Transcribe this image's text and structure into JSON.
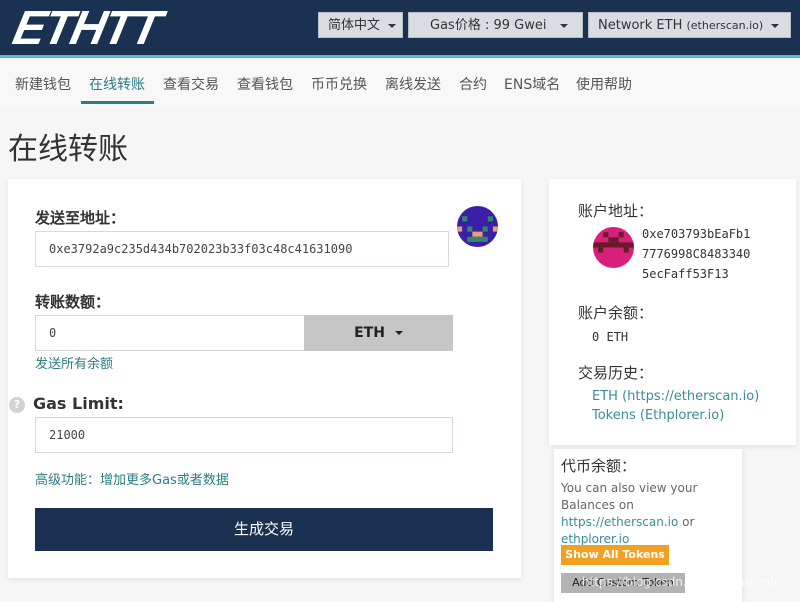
{
  "header": {
    "logo": "ETHTT",
    "language": "简体中文",
    "gas_price": "Gas价格 : 99 Gwei",
    "network_prefix": "Network ETH ",
    "network_suffix": "(etherscan.io)"
  },
  "nav": {
    "items": [
      {
        "label": "新建钱包"
      },
      {
        "label": "在线转账",
        "active": true
      },
      {
        "label": "查看交易"
      },
      {
        "label": "查看钱包"
      },
      {
        "label": "币币兑换"
      },
      {
        "label": "离线发送"
      },
      {
        "label": "合约"
      },
      {
        "label": "ENS域名"
      },
      {
        "label": "使用帮助"
      }
    ]
  },
  "page": {
    "title": "在线转账"
  },
  "form": {
    "to_label": "发送至地址：",
    "to_value": "0xe3792a9c235d434b702023b33f03c48c41631090",
    "amount_label": "转账数额：",
    "amount_value": "0",
    "currency": "ETH",
    "send_all": "发送所有余额",
    "gas_limit_label": "Gas Limit:",
    "gas_limit_value": "21000",
    "help_icon": "?",
    "advanced_link": "高级功能：增加更多Gas或者数据",
    "generate_button": "生成交易"
  },
  "account": {
    "address_label": "账户地址：",
    "address_lines": [
      "0xe703793bEaFb1",
      "7776998C8483340",
      "5ecFaff53F13"
    ],
    "balance_label": "账户余额：",
    "balance_value": "0 ETH",
    "history_label": "交易历史：",
    "history_links": [
      "ETH (https://etherscan.io)",
      "Tokens (Ethplorer.io)"
    ]
  },
  "tokens": {
    "title": "代币余额：",
    "text_prefix": "You can also view your Balances on ",
    "link1": "https://etherscan.io",
    "text_mid": " or ",
    "link2": "ethplorer.io",
    "show_all_button": "Show All Tokens",
    "add_custom_button": "Add Custom Token"
  },
  "colors": {
    "header_bg": "#1b3152",
    "accent": "#2d7c84",
    "orange": "#f2a024"
  },
  "watermark": "https://blog.csdn.net/ops_ad_min"
}
